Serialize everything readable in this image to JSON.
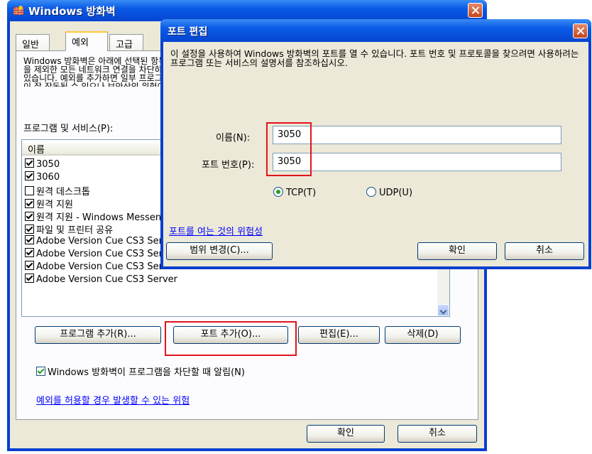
{
  "main_window": {
    "title": "Windows 방화벽",
    "tabs": [
      "일반",
      "예외",
      "고급"
    ],
    "description": "Windows 방화벽은 아래에 선택된 항목을 제외한 모든 네트워크 연결을 차단하고 있습니다. 예외를 추가하면 일부 프로그램이 잘 작동될 수 있으나 보안상의 위험이 증가할 수 있습니다.",
    "programs_label": "프로그램 및 서비스(P):",
    "column_name": "이름",
    "list_items": [
      {
        "label": "3050",
        "checked": true
      },
      {
        "label": "3060",
        "checked": true
      },
      {
        "label": "원격 데스크톱",
        "checked": false
      },
      {
        "label": "원격 지원",
        "checked": true
      },
      {
        "label": "원격 지원 - Windows Messenger 및 음성",
        "checked": true
      },
      {
        "label": "파일 및 프린터 공유",
        "checked": true
      },
      {
        "label": "Adobe Version Cue CS3 Server",
        "checked": true
      },
      {
        "label": "Adobe Version Cue CS3 Server",
        "checked": true
      },
      {
        "label": "Adobe Version Cue CS3 Server",
        "checked": true
      },
      {
        "label": "Adobe Version Cue CS3 Server",
        "checked": true
      }
    ],
    "buttons": {
      "add_program": "프로그램 추가(R)...",
      "add_port": "포트 추가(O)...",
      "edit": "편집(E)...",
      "delete": "삭제(D)"
    },
    "notify_label": "Windows 방화벽이 프로그램을 차단할 때 알림(N)",
    "risk_link": "예외를 허용할 경우 발생할 수 있는 위험",
    "ok": "확인",
    "cancel": "취소"
  },
  "port_dialog": {
    "title": "포트 편집",
    "description": "이 설정을 사용하여 Windows 방화벽의 포트를 열 수 있습니다. 포트 번호 및 프로토콜을 찾으려면 사용하려는 프로그램 또는 서비스의 설명서를 참조하십시오.",
    "name_label": "이름(N):",
    "name_value": "3050",
    "port_label": "포트 번호(P):",
    "port_value": "3050",
    "tcp_label": "TCP(T)",
    "udp_label": "UDP(U)",
    "protocol_selected": "TCP",
    "risk_link": "포트를 여는 것의 위험성",
    "scope_button": "범위 변경(C)...",
    "ok": "확인",
    "cancel": "취소"
  },
  "colors": {
    "highlight_box": "#e3141b",
    "titlebar": "#0a5ae6",
    "link": "#0000ff"
  }
}
